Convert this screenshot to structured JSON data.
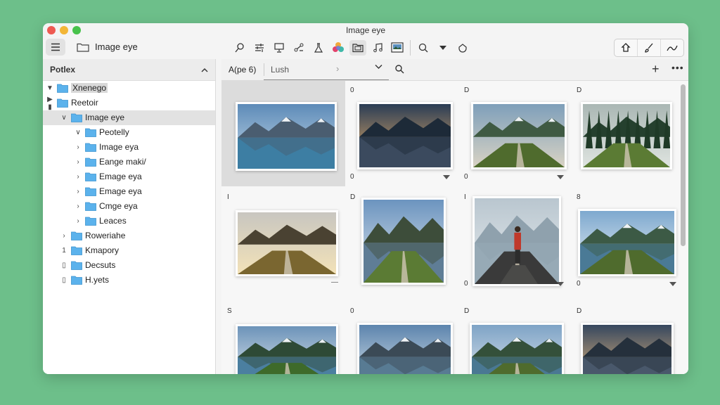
{
  "window": {
    "title": "Image eye"
  },
  "toolbar": {
    "location_label": "Image eye",
    "icons": [
      "search-icon",
      "sliders-icon",
      "monitor-icon",
      "share-icon",
      "flask-icon",
      "color-wheel-icon",
      "folder-icon",
      "music-icon",
      "image-icon",
      "zoom-icon",
      "dropdown-icon",
      "sync-icon"
    ],
    "right_icons": [
      "home-icon",
      "brush-icon",
      "curve-icon"
    ]
  },
  "sidebar": {
    "header": "Potlex",
    "items": [
      {
        "label": "Xnenego",
        "depth": 0,
        "toggle": "▼",
        "highlight": true
      },
      {
        "label": "Reetoir",
        "depth": 0,
        "toggle": "▶ ▮"
      },
      {
        "label": "Image eye",
        "depth": 1,
        "toggle": "∨",
        "selected": true
      },
      {
        "label": "Peotelly",
        "depth": 2,
        "toggle": "∨"
      },
      {
        "label": "Image eya",
        "depth": 2,
        "toggle": "›"
      },
      {
        "label": "Eange maki/",
        "depth": 2,
        "toggle": "›"
      },
      {
        "label": "Emage eya",
        "depth": 2,
        "toggle": "›"
      },
      {
        "label": "Emage eya",
        "depth": 2,
        "toggle": "›"
      },
      {
        "label": "Cmge eya",
        "depth": 2,
        "toggle": "›"
      },
      {
        "label": "Leaces",
        "depth": 2,
        "toggle": "›"
      },
      {
        "label": "Roweriahe",
        "depth": 1,
        "toggle": "›"
      },
      {
        "label": "Kmapory",
        "depth": 1,
        "toggle": "1"
      },
      {
        "label": "Decsuts",
        "depth": 1,
        "toggle": "▯"
      },
      {
        "label": "H.yets",
        "depth": 1,
        "toggle": "▯"
      }
    ]
  },
  "pathbar": {
    "crumb1": "A(pe 6)",
    "crumb2": "Lush"
  },
  "grid": {
    "cells": [
      {
        "top": "",
        "bottom": "",
        "scene": "lake",
        "selected": true
      },
      {
        "top": "0",
        "bottom": "0",
        "scene": "sunset"
      },
      {
        "top": "D",
        "bottom": "0",
        "scene": "valley"
      },
      {
        "top": "D",
        "bottom": "",
        "scene": "forest"
      },
      {
        "top": "I",
        "bottom": "",
        "scene": "canyon",
        "marker": "—"
      },
      {
        "top": "D",
        "bottom": "",
        "scene": "river"
      },
      {
        "top": "I",
        "bottom": "0",
        "scene": "person"
      },
      {
        "top": "8",
        "bottom": "0",
        "scene": "lake2"
      },
      {
        "top": "S",
        "bottom": "",
        "scene": "lake3"
      },
      {
        "top": "0",
        "bottom": "",
        "scene": "lake4"
      },
      {
        "top": "D",
        "bottom": "",
        "scene": "lake5"
      },
      {
        "top": "D",
        "bottom": "",
        "scene": "sunset2"
      }
    ]
  }
}
